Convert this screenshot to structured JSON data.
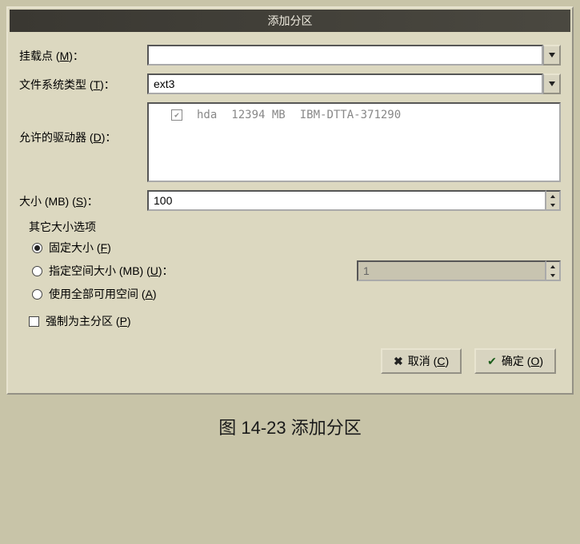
{
  "title": "添加分区",
  "mount_point": {
    "label_pre": "挂载点 (",
    "hotkey": "M",
    "label_post": ")：",
    "value": ""
  },
  "fs_type": {
    "label_pre": "文件系统类型 (",
    "hotkey": "T",
    "label_post": ")：",
    "value": "ext3"
  },
  "drives": {
    "label_pre": "允许的驱动器 (",
    "hotkey": "D",
    "label_post": ")：",
    "items": [
      {
        "checked": true,
        "dev": "hda",
        "size": "12394  MB",
        "model": "IBM-DTTA-371290"
      }
    ]
  },
  "size": {
    "label_pre": "大小 (MB) (",
    "hotkey": "S",
    "label_post": ")：",
    "value": "100"
  },
  "size_options": {
    "group": "其它大小选项",
    "fixed": {
      "label_pre": "固定大小 (",
      "hotkey": "F",
      "label_post": ")"
    },
    "specify": {
      "label_pre": "指定空间大小 (MB) (",
      "hotkey": "U",
      "label_post": ")：",
      "value": "1"
    },
    "fill": {
      "label_pre": "使用全部可用空间 (",
      "hotkey": "A",
      "label_post": ")"
    }
  },
  "primary": {
    "label_pre": "强制为主分区 (",
    "hotkey": "P",
    "label_post": ")"
  },
  "buttons": {
    "cancel": {
      "label_pre": "取消 (",
      "hotkey": "C",
      "label_post": ")"
    },
    "ok": {
      "label_pre": "确定 (",
      "hotkey": "O",
      "label_post": ")"
    }
  },
  "caption": "图 14-23  添加分区"
}
